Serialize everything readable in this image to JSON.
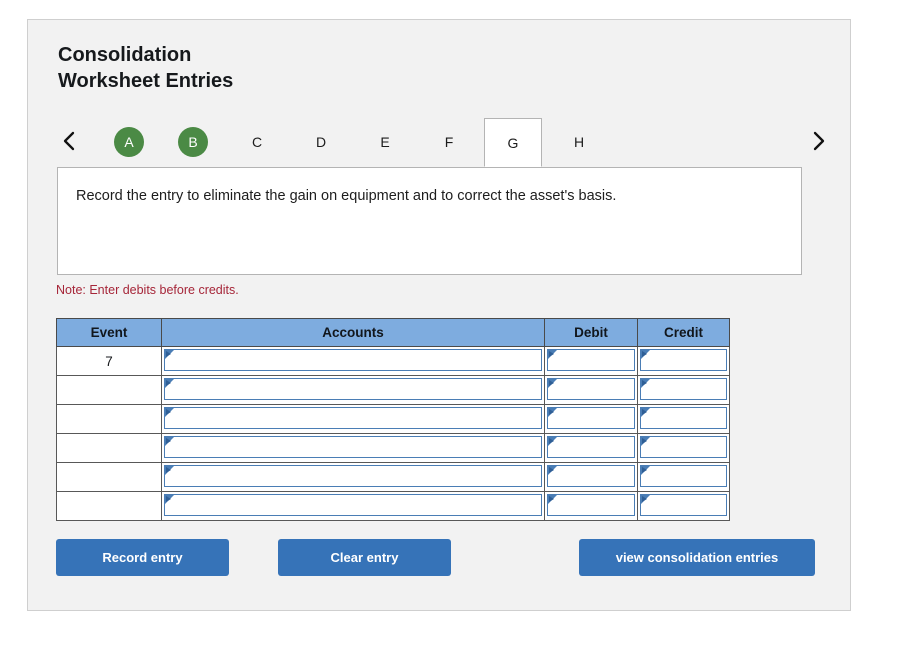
{
  "header": {
    "title": "Consolidation\nWorksheet Entries"
  },
  "tabbar": {
    "prev_icon": "chevron-left-icon",
    "next_icon": "chevron-right-icon",
    "tabs": [
      {
        "label": "A",
        "state": "completed"
      },
      {
        "label": "B",
        "state": "completed"
      },
      {
        "label": "C",
        "state": "default"
      },
      {
        "label": "D",
        "state": "default"
      },
      {
        "label": "E",
        "state": "default"
      },
      {
        "label": "F",
        "state": "default"
      },
      {
        "label": "G",
        "state": "active"
      },
      {
        "label": "H",
        "state": "default"
      }
    ],
    "active_tab": "G",
    "completed_color": "#4b8a45"
  },
  "instruction": {
    "text": "Record the entry to eliminate the gain on equipment and to correct the asset's basis."
  },
  "note": {
    "text": "Note: Enter debits before credits.",
    "color": "#a62639"
  },
  "table": {
    "header_color": "#7eacdf",
    "columns": [
      "Event",
      "Accounts",
      "Debit",
      "Credit"
    ],
    "rows": [
      {
        "event": "7",
        "account": "",
        "debit": "",
        "credit": ""
      },
      {
        "event": "",
        "account": "",
        "debit": "",
        "credit": ""
      },
      {
        "event": "",
        "account": "",
        "debit": "",
        "credit": ""
      },
      {
        "event": "",
        "account": "",
        "debit": "",
        "credit": ""
      },
      {
        "event": "",
        "account": "",
        "debit": "",
        "credit": ""
      },
      {
        "event": "",
        "account": "",
        "debit": "",
        "credit": ""
      }
    ]
  },
  "buttons": {
    "record": "Record entry",
    "clear": "Clear entry",
    "view": "view consolidation entries",
    "color": "#3673b8"
  }
}
